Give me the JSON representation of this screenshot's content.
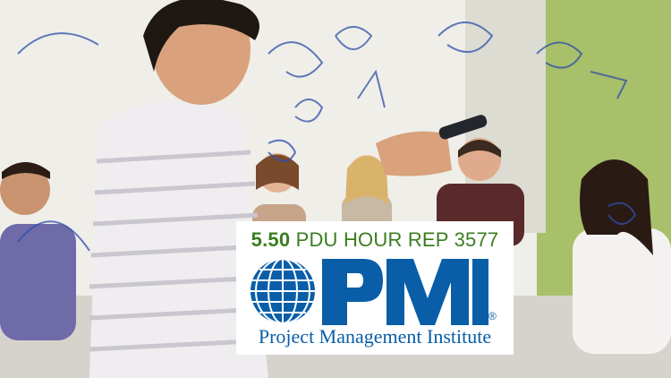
{
  "image": {
    "description_colors": {
      "wall": "#f2f0ea",
      "green_wall": "#9bb85a",
      "marker": "#2f4fa8",
      "shirt": "#efedf0"
    }
  },
  "badge": {
    "pdu_prefix": "5.50",
    "pdu_text": "PDU HOUR REP 3577",
    "logo_letters": "PMI",
    "registered_mark": "®",
    "org_name": "Project Management Institute",
    "colors": {
      "title_green": "#3a7d1e",
      "pmi_blue": "#0a5ea8"
    }
  }
}
